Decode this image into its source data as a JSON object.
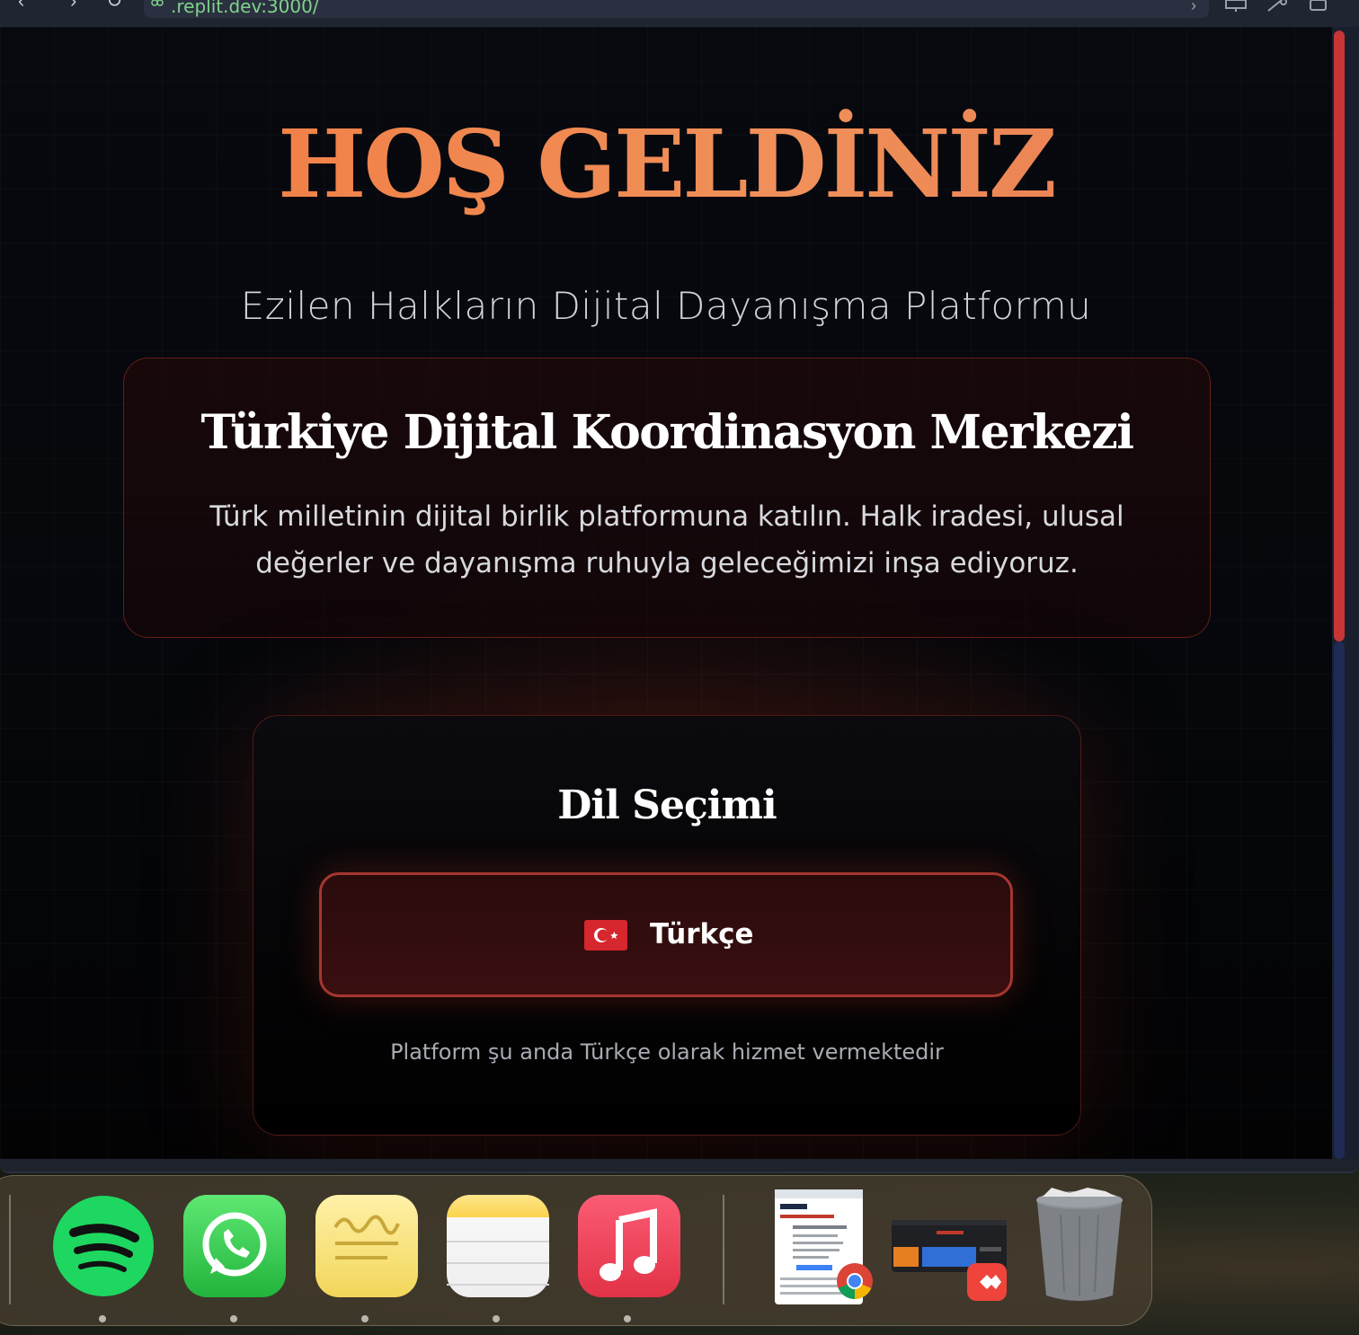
{
  "browser": {
    "url": ".replit.dev:3000/"
  },
  "hero": {
    "title": "HOŞ GELDİNİZ",
    "subtitle": "Ezilen Halkların Dijital Dayanışma Platformu"
  },
  "intro_card": {
    "title": "Türkiye Dijital Koordinasyon Merkezi",
    "text": "Türk milletinin dijital birlik platformuna katılın. Halk iradesi, ulusal değerler ve dayanışma ruhuyla geleceğimizi inşa ediyoruz."
  },
  "language_card": {
    "title": "Dil Seçimi",
    "button_label": "Türkçe",
    "button_flag": "turkey-flag-icon",
    "note": "Platform şu anda Türkçe olarak hizmet vermektedir"
  },
  "dock": {
    "apps": [
      "spotify-icon",
      "whatsapp-icon",
      "stickies-icon",
      "notes-icon",
      "music-icon",
      "chrome-window-thumbnail",
      "anydesk-window-thumbnail",
      "trash-icon"
    ]
  },
  "colors": {
    "accent": "#f07a3f",
    "button_border": "#a5372f",
    "scroll_thumb": "#c73535"
  }
}
